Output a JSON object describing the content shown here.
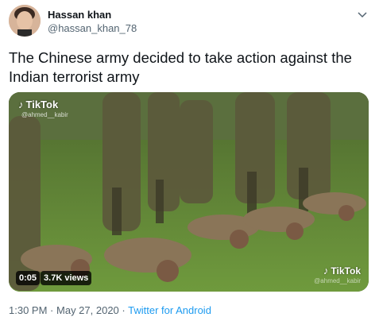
{
  "author": {
    "display_name": "Hassan khan",
    "handle": "@hassan_khan_78"
  },
  "tweet": {
    "text": "The Chinese army decided to take action against the Indian terrorist army"
  },
  "media": {
    "watermark_top": {
      "brand": "TikTok",
      "user": "@ahmed__kabir"
    },
    "watermark_bottom": {
      "brand": "TikTok",
      "user": "@ahmed__kabir"
    },
    "duration": "0:05",
    "views": "3.7K views"
  },
  "meta": {
    "time": "1:30 PM",
    "separator": "·",
    "date": "May 27, 2020",
    "source": "Twitter for Android"
  },
  "icons": {
    "menu": "chevron-down-icon",
    "tiktok": "tiktok-logo-icon"
  },
  "colors": {
    "text_primary": "#0f1419",
    "text_secondary": "#536471",
    "link": "#1d9bf0"
  }
}
